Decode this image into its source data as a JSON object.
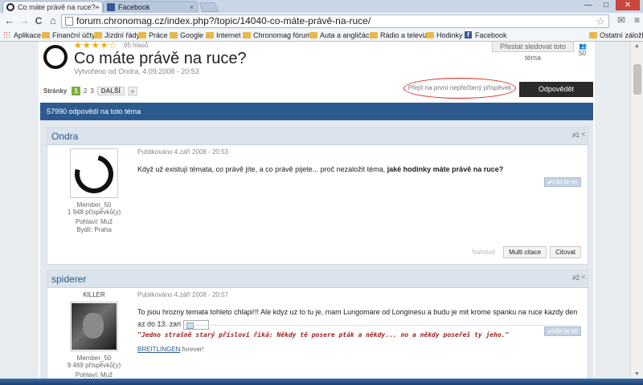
{
  "browser": {
    "tabs": [
      {
        "title": "Co máte právě na ruce? -",
        "close": "×"
      },
      {
        "title": "Facebook",
        "close": "×"
      }
    ],
    "window_controls": {
      "minimize": "—",
      "maximize": "□",
      "close": "✕"
    },
    "nav": {
      "back": "←",
      "forward": "→",
      "reload": "C",
      "home": "⌂"
    },
    "url": "forum.chronomag.cz/index.php?/topic/14040-co-máte-právě-na-ruce/",
    "bookmarks": [
      {
        "label": "Aplikace",
        "icon": "apps-icon"
      },
      {
        "label": "Finanční účty",
        "icon": "folder-icon"
      },
      {
        "label": "Jízdní řády",
        "icon": "folder-icon"
      },
      {
        "label": "Práce",
        "icon": "folder-icon"
      },
      {
        "label": "Google",
        "icon": "folder-icon"
      },
      {
        "label": "Internet",
        "icon": "folder-icon"
      },
      {
        "label": "Chronomag fórum",
        "icon": "folder-icon"
      },
      {
        "label": "Auta a angličáci",
        "icon": "folder-icon"
      },
      {
        "label": "Rádio a televize",
        "icon": "folder-icon"
      },
      {
        "label": "Hodinky",
        "icon": "folder-icon"
      },
      {
        "label": "Facebook",
        "icon": "facebook-icon"
      },
      {
        "label": "Ostatní záložky",
        "icon": "folder-icon"
      }
    ]
  },
  "topic": {
    "rating_stars": "★★★★☆",
    "votes": "95 hlasů",
    "title": "Co máte právě na ruce?",
    "created": "Vytvořeno od Ondra, 4.09.2008 - 20:53",
    "follow_button": "Přestat sledovat toto téma",
    "follow_count": "50",
    "pager": {
      "label": "Stránky",
      "pages": [
        "1",
        "2",
        "3"
      ],
      "next": "DALŠÍ",
      "last": "»"
    },
    "first_unread": "Přejít na první nepřečtený příspěvek",
    "reply_button": "Odpovědět",
    "reply_count": "57990 odpovědí na toto téma"
  },
  "posts": [
    {
      "author": "Ondra",
      "number": "#1",
      "share": "<",
      "rank": "Member_50",
      "post_count": "1 948 příspěvků(y)",
      "gender": "Pohlaví: Muž",
      "location": "Bydlí: Praha",
      "posted": "Publikováno 4.září 2008 - 20:53",
      "text_plain": "Když už existují témata, co právě jíte, a co právě pijete... proč nezaložit téma, ",
      "text_bold": "jaké hodinky máte právě na ruce?",
      "like": "Líbí se mi",
      "report": "Nahlásit",
      "multiquote": "Multi citace",
      "quote": "Citovat"
    },
    {
      "author": "spiderer",
      "number": "#2",
      "share": "<",
      "title_label": "KILLER",
      "rank": "Member_50",
      "post_count": "9 469 příspěvků(y)",
      "gender": "Pohlaví: Muž",
      "posted": "Publikováno 4.září 2008 - 20:57",
      "text": "To jsou hrozny temata tohleto chlapi!!! Ale kdyz uz to tu je, mam Lungomare od Longinesu a budu je mit krome spanku na ruce kazdy den az do 13. zari",
      "like": "Líbí se mi",
      "signature": "\"Jedno strašně starý přísloví říká: Někdy tě posere pták a někdy... no a někdy poseřeš ty jeho.\"",
      "signature_link": "BREITLINGEN",
      "signature_rest": " forever!"
    }
  ]
}
